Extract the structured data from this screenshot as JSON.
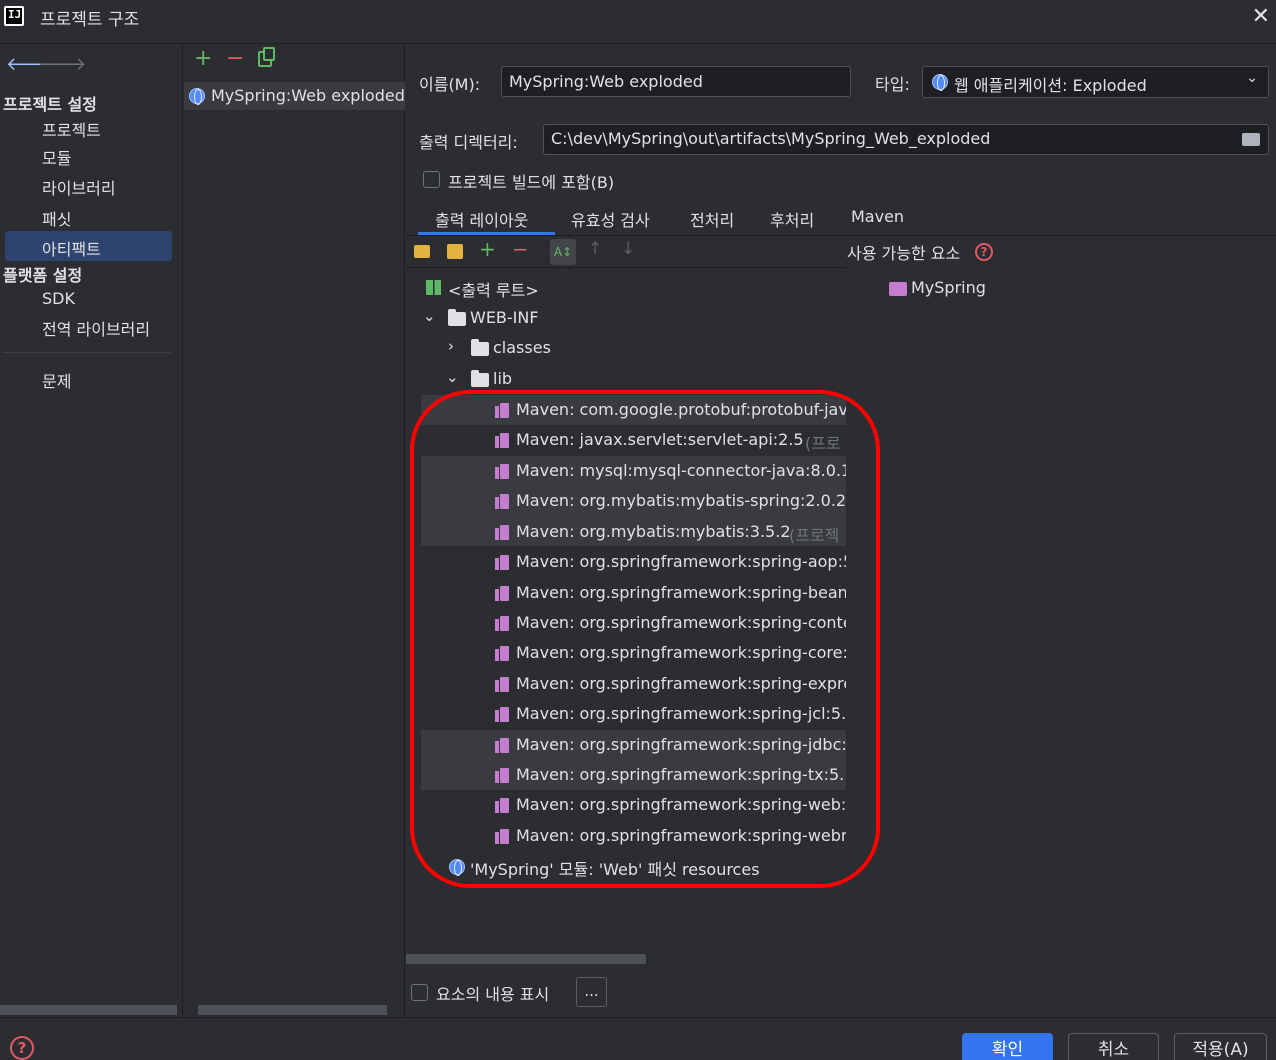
{
  "window": {
    "title": "프로젝트 구조",
    "close": "✕"
  },
  "nav": {
    "back": "🡐",
    "forward": "🡒",
    "project_settings_header": "프로젝트 설정",
    "project_settings_items": [
      "프로젝트",
      "모듈",
      "라이브러리",
      "패싯",
      "아티팩트"
    ],
    "platform_settings_header": "플랫폼 설정",
    "platform_settings_items": [
      "SDK",
      "전역 라이브러리"
    ],
    "problems": "문제",
    "selected_item": "아티팩트"
  },
  "artifacts": {
    "add": "+",
    "remove": "−",
    "items": [
      "MySpring:Web exploded"
    ]
  },
  "form": {
    "name_label": "이름(M):",
    "name_value": "MySpring:Web exploded",
    "type_label": "타입:",
    "type_value": "웹 애플리케이션: Exploded",
    "output_dir_label": "출력 디렉터리:",
    "output_dir_value": "C:\\dev\\MySpring\\out\\artifacts\\MySpring_Web_exploded",
    "include_in_build_label": "프로젝트 빌드에 포함(B)",
    "include_in_build": false
  },
  "tabs": [
    "출력 레이아웃",
    "유효성 검사",
    "전처리",
    "후처리",
    "Maven"
  ],
  "active_tab": "출력 레이아웃",
  "tree": {
    "root": "<출력 루트>",
    "web_inf": "WEB-INF",
    "classes": "classes",
    "lib": "lib",
    "libs": [
      {
        "name": "Maven: com.google.protobuf:protobuf-jav",
        "suffix": "",
        "selected": true
      },
      {
        "name": "Maven: javax.servlet:servlet-api:2.5",
        "suffix": "(프로",
        "selected": false
      },
      {
        "name": "Maven: mysql:mysql-connector-java:8.0.1",
        "suffix": "",
        "selected": true
      },
      {
        "name": "Maven: org.mybatis:mybatis-spring:2.0.2",
        "suffix": "",
        "selected": true
      },
      {
        "name": "Maven: org.mybatis:mybatis:3.5.2",
        "suffix": "(프로젝",
        "selected": true
      },
      {
        "name": "Maven: org.springframework:spring-aop:5",
        "suffix": "",
        "selected": false
      },
      {
        "name": "Maven: org.springframework:spring-bean",
        "suffix": "",
        "selected": false
      },
      {
        "name": "Maven: org.springframework:spring-conte",
        "suffix": "",
        "selected": false
      },
      {
        "name": "Maven: org.springframework:spring-core:",
        "suffix": "",
        "selected": false
      },
      {
        "name": "Maven: org.springframework:spring-expre",
        "suffix": "",
        "selected": false
      },
      {
        "name": "Maven: org.springframework:spring-jcl:5.",
        "suffix": "",
        "selected": false
      },
      {
        "name": "Maven: org.springframework:spring-jdbc:",
        "suffix": "",
        "selected": true
      },
      {
        "name": "Maven: org.springframework:spring-tx:5.",
        "suffix": "",
        "selected": true
      },
      {
        "name": "Maven: org.springframework:spring-web:",
        "suffix": "",
        "selected": false
      },
      {
        "name": "Maven: org.springframework:spring-webr",
        "suffix": "",
        "selected": false
      }
    ],
    "resources": "'MySpring' 모듈: 'Web' 패싯 resources"
  },
  "available": {
    "label": "사용 가능한 요소",
    "help": "?",
    "items": [
      "MySpring"
    ]
  },
  "show_contents_label": "요소의 내용 표시",
  "ellipsis": "...",
  "buttons": {
    "ok": "확인",
    "cancel": "취소",
    "apply": "적용(A)"
  },
  "help_icon": "?",
  "colors": {
    "accent": "#3574f0",
    "annotation": "#ff0000",
    "library": "#c77dcf"
  }
}
